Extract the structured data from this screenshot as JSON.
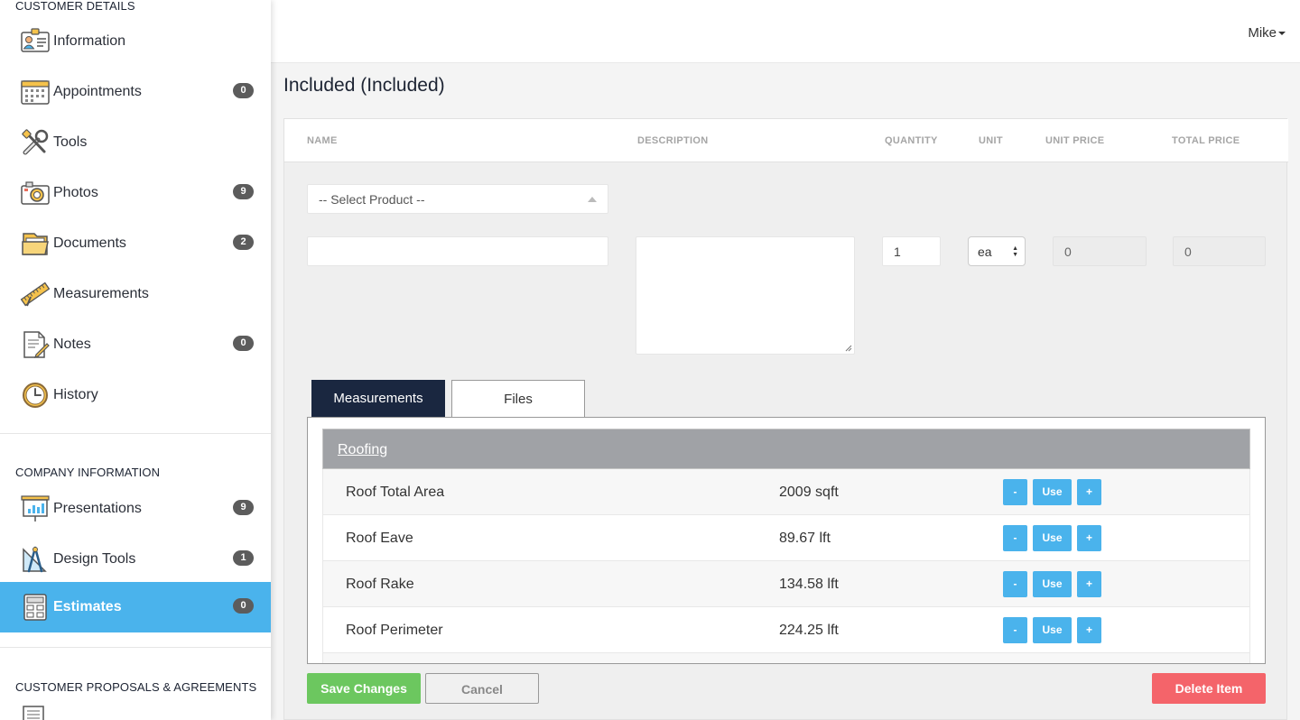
{
  "sidebar": {
    "customer_details_title": "CUSTOMER DETAILS",
    "company_information_title": "COMPANY INFORMATION",
    "customer_proposals_title": "CUSTOMER PROPOSALS & AGREEMENTS",
    "items": [
      {
        "label": "Information",
        "icon": "contact-card-icon",
        "badge": null
      },
      {
        "label": "Appointments",
        "icon": "calendar-icon",
        "badge": "0"
      },
      {
        "label": "Tools",
        "icon": "tools-icon",
        "badge": null
      },
      {
        "label": "Photos",
        "icon": "camera-icon",
        "badge": "9"
      },
      {
        "label": "Documents",
        "icon": "folder-icon",
        "badge": "2"
      },
      {
        "label": "Measurements",
        "icon": "ruler-icon",
        "badge": null
      },
      {
        "label": "Notes",
        "icon": "notes-icon",
        "badge": "0"
      },
      {
        "label": "History",
        "icon": "clock-icon",
        "badge": null
      },
      {
        "label": "Presentations",
        "icon": "presentation-board-icon",
        "badge": "9"
      },
      {
        "label": "Design Tools",
        "icon": "drafting-compass-icon",
        "badge": "1"
      },
      {
        "label": "Estimates",
        "icon": "calculator-icon",
        "badge": "0",
        "active": true
      }
    ]
  },
  "topbar": {
    "user_name": "Mike"
  },
  "page": {
    "title": "Included  (Included)"
  },
  "table_headers": {
    "name": "NAME",
    "description": "DESCRIPTION",
    "quantity": "QUANTITY",
    "unit": "UNIT",
    "unit_price": "UNIT PRICE",
    "total_price": "TOTAL PRICE"
  },
  "form": {
    "select_product_placeholder": "-- Select Product --",
    "name_value": "",
    "description_value": "",
    "quantity_value": "1",
    "unit_value": "ea",
    "unit_price_value": "0",
    "total_price_value": "0"
  },
  "tabs": {
    "measurements": "Measurements",
    "files": "Files"
  },
  "measurements": {
    "group_name": "Roofing",
    "button_minus": "-",
    "button_use": "Use",
    "button_plus": "+",
    "rows": [
      {
        "name": "Roof Total Area",
        "value": "2009 sqft"
      },
      {
        "name": "Roof Eave",
        "value": "89.67 lft"
      },
      {
        "name": "Roof Rake",
        "value": "134.58 lft"
      },
      {
        "name": "Roof Perimeter",
        "value": "224.25 lft"
      }
    ]
  },
  "actions": {
    "save": "Save Changes",
    "cancel": "Cancel",
    "delete": "Delete Item"
  },
  "colors": {
    "accent": "#4ab3ec",
    "save": "#6cc75f",
    "delete": "#f4646a",
    "active_tab": "#1a2740"
  }
}
